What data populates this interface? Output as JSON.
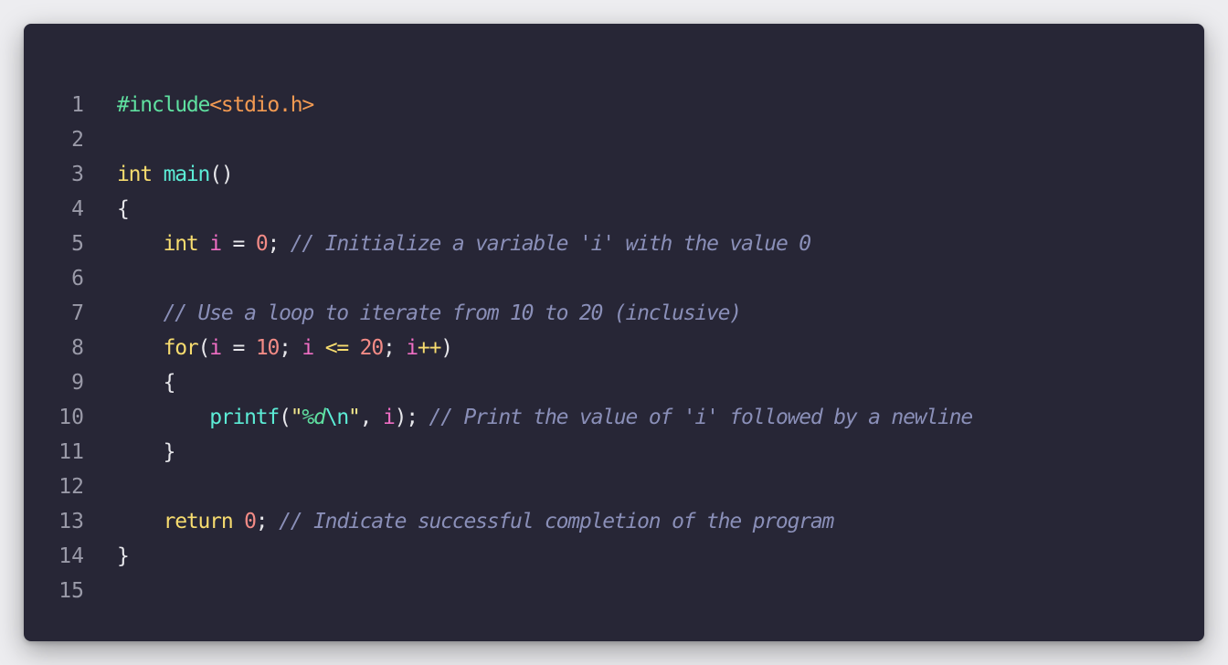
{
  "editor": {
    "language": "c",
    "colors": {
      "background": "#272636",
      "page": "#ededf0",
      "line_number": "#9a9aa8",
      "preprocessor": "#5fe0a0",
      "include": "#f29a52",
      "keyword": "#f7dc6f",
      "function": "#5cecd6",
      "variable": "#ef6ec4",
      "number": "#f38b86",
      "comment": "#8a8fb8"
    },
    "lines": [
      {
        "n": "1",
        "tokens": [
          {
            "t": "#include",
            "c": "pre"
          },
          {
            "t": "<stdio.h>",
            "c": "inc"
          }
        ]
      },
      {
        "n": "2",
        "tokens": []
      },
      {
        "n": "3",
        "tokens": [
          {
            "t": "int",
            "c": "kw"
          },
          {
            "t": " ",
            "c": "plain"
          },
          {
            "t": "main",
            "c": "fn"
          },
          {
            "t": "()",
            "c": "punc"
          }
        ]
      },
      {
        "n": "4",
        "tokens": [
          {
            "t": "{",
            "c": "punc"
          }
        ]
      },
      {
        "n": "5",
        "tokens": [
          {
            "t": "    ",
            "c": "plain"
          },
          {
            "t": "int",
            "c": "kw"
          },
          {
            "t": " ",
            "c": "plain"
          },
          {
            "t": "i",
            "c": "var"
          },
          {
            "t": " = ",
            "c": "plain"
          },
          {
            "t": "0",
            "c": "num"
          },
          {
            "t": "; ",
            "c": "punc"
          },
          {
            "t": "// Initialize a variable 'i' with the value 0",
            "c": "com"
          }
        ]
      },
      {
        "n": "6",
        "tokens": []
      },
      {
        "n": "7",
        "tokens": [
          {
            "t": "    ",
            "c": "plain"
          },
          {
            "t": "// Use a loop to iterate from 10 to 20 (inclusive)",
            "c": "com"
          }
        ]
      },
      {
        "n": "8",
        "tokens": [
          {
            "t": "    ",
            "c": "plain"
          },
          {
            "t": "for",
            "c": "kw"
          },
          {
            "t": "(",
            "c": "punc"
          },
          {
            "t": "i",
            "c": "var"
          },
          {
            "t": " = ",
            "c": "plain"
          },
          {
            "t": "10",
            "c": "num"
          },
          {
            "t": "; ",
            "c": "punc"
          },
          {
            "t": "i",
            "c": "var"
          },
          {
            "t": " ",
            "c": "plain"
          },
          {
            "t": "<=",
            "c": "op"
          },
          {
            "t": " ",
            "c": "plain"
          },
          {
            "t": "20",
            "c": "num"
          },
          {
            "t": "; ",
            "c": "punc"
          },
          {
            "t": "i",
            "c": "var"
          },
          {
            "t": "++",
            "c": "op"
          },
          {
            "t": ")",
            "c": "punc"
          }
        ]
      },
      {
        "n": "9",
        "tokens": [
          {
            "t": "    ",
            "c": "plain"
          },
          {
            "t": "{",
            "c": "punc"
          }
        ]
      },
      {
        "n": "10",
        "tokens": [
          {
            "t": "        ",
            "c": "plain"
          },
          {
            "t": "printf",
            "c": "fn"
          },
          {
            "t": "(",
            "c": "punc"
          },
          {
            "t": "\"",
            "c": "str"
          },
          {
            "t": "%d",
            "c": "fmt"
          },
          {
            "t": "\\n",
            "c": "esc"
          },
          {
            "t": "\"",
            "c": "str"
          },
          {
            "t": ", ",
            "c": "punc"
          },
          {
            "t": "i",
            "c": "var"
          },
          {
            "t": "); ",
            "c": "punc"
          },
          {
            "t": "// Print the value of 'i' followed by a newline",
            "c": "com"
          }
        ]
      },
      {
        "n": "11",
        "tokens": [
          {
            "t": "    ",
            "c": "plain"
          },
          {
            "t": "}",
            "c": "punc"
          }
        ]
      },
      {
        "n": "12",
        "tokens": []
      },
      {
        "n": "13",
        "tokens": [
          {
            "t": "    ",
            "c": "plain"
          },
          {
            "t": "return",
            "c": "kw"
          },
          {
            "t": " ",
            "c": "plain"
          },
          {
            "t": "0",
            "c": "num"
          },
          {
            "t": "; ",
            "c": "punc"
          },
          {
            "t": "// Indicate successful completion of the program",
            "c": "com"
          }
        ]
      },
      {
        "n": "14",
        "tokens": [
          {
            "t": "}",
            "c": "punc"
          }
        ]
      },
      {
        "n": "15",
        "tokens": []
      }
    ]
  }
}
